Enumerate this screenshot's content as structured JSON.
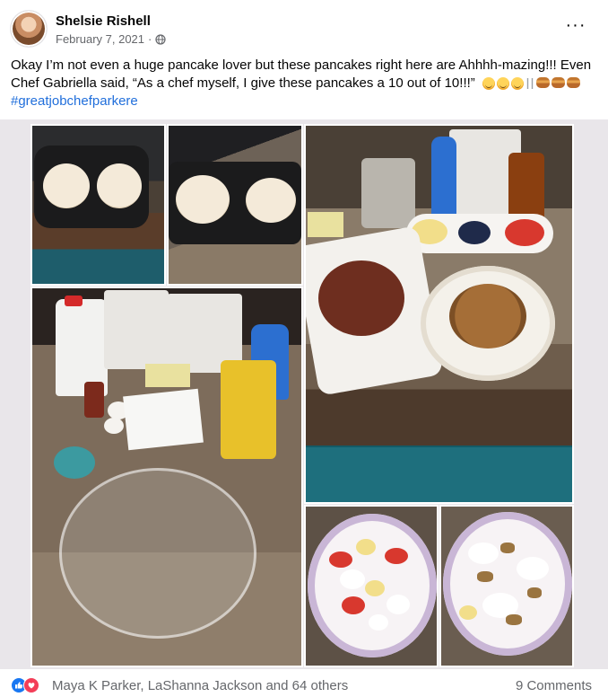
{
  "post": {
    "author": "Shelsie Rishell",
    "date": "February 7, 2021",
    "separator": "·",
    "privacy_icon": "globe-icon",
    "more_icon": "more-options-icon",
    "more_label": "···",
    "text": "Okay I’m not even a huge pancake lover but these pancakes right here are Ahhhh-mazing!!! Even Chef Gabriella said, “As a chef myself, I give these pancakes a 10 out of 10!!!”",
    "hashtag": "#greatjobchefparkere",
    "emojis": [
      "grinning-face-icon",
      "grinning-face-icon",
      "grinning-face-icon",
      "fork-knife-icon",
      "pancakes-icon",
      "pancakes-icon",
      "pancakes-icon"
    ]
  },
  "photos": [
    {
      "name": "pancakes-griddle-photo"
    },
    {
      "name": "pancakes-cooking-photo"
    },
    {
      "name": "breakfast-spread-photo"
    },
    {
      "name": "ingredients-photo"
    },
    {
      "name": "pancake-plate-strawberry-photo"
    },
    {
      "name": "pancake-plate-nuts-photo"
    }
  ],
  "footer": {
    "reaction_icons": [
      "like-icon",
      "love-icon"
    ],
    "reactors": "Maya K Parker, LaShanna Jackson and 64 others",
    "comments": "9 Comments"
  },
  "colors": {
    "link": "#216fdb",
    "secondary_text": "#65676b",
    "like": "#1877f2",
    "love": "#f33e58"
  }
}
